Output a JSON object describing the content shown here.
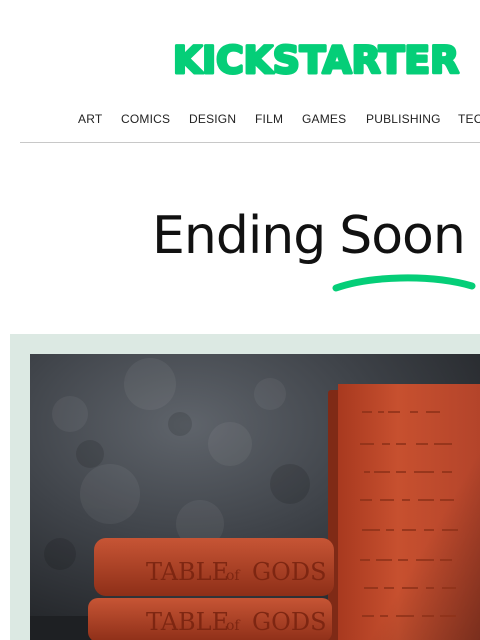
{
  "brand": {
    "name": "KICKSTARTER",
    "color": "#05ce78"
  },
  "nav": {
    "items": [
      "ART",
      "COMICS",
      "DESIGN",
      "FILM",
      "GAMES",
      "PUBLISHING",
      "TEC"
    ]
  },
  "headline": {
    "word1": "Ending",
    "word2": "Soon",
    "underline_color": "#05ce78"
  },
  "feature": {
    "background_color": "#dce9e3",
    "book_title_word1": "TABLE",
    "book_title_word2": "of",
    "book_title_word3": "GODS",
    "book_color": "#c0482e"
  }
}
